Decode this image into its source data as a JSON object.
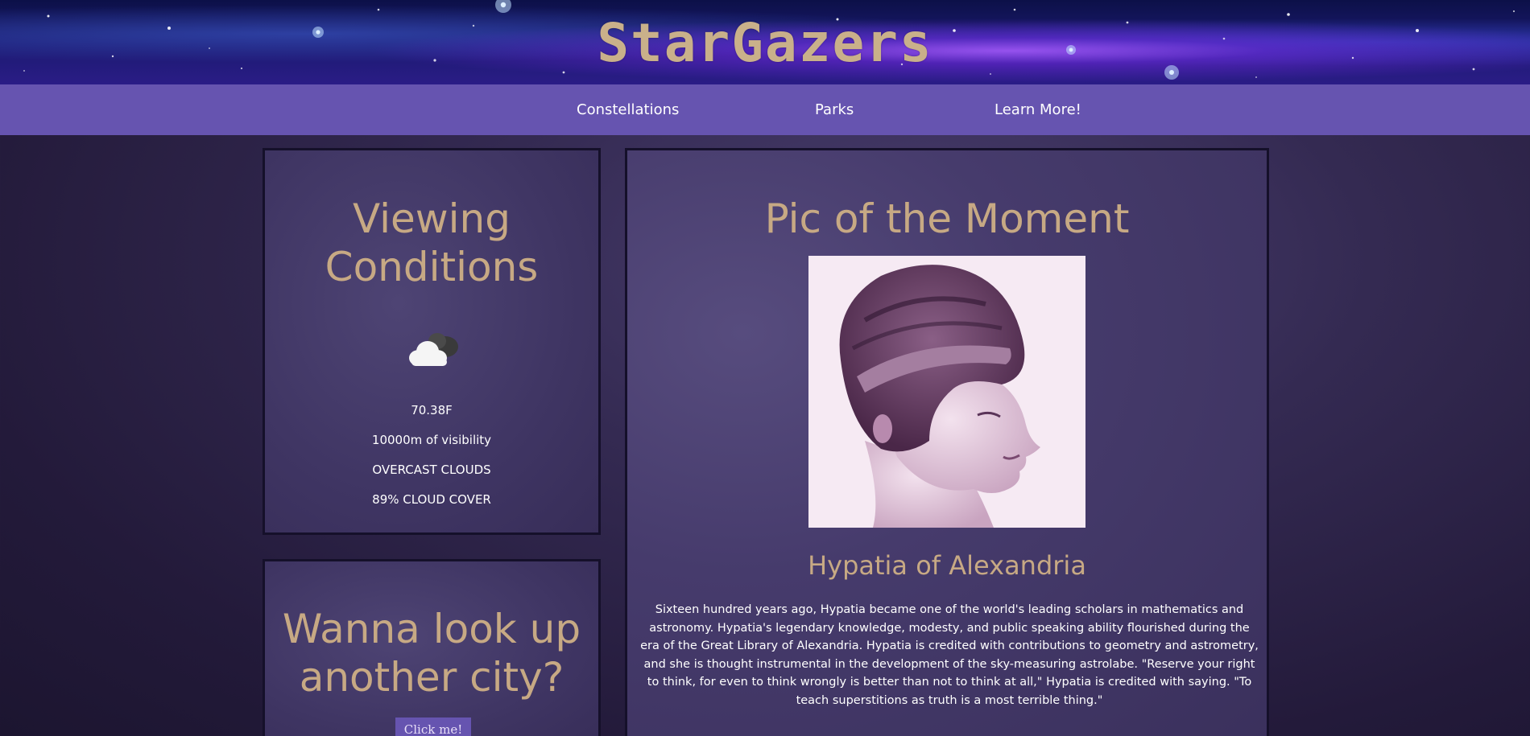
{
  "header": {
    "logo_text": "StarGazers"
  },
  "nav": {
    "items": [
      {
        "label": "Constellations"
      },
      {
        "label": "Parks"
      },
      {
        "label": "Learn More!"
      }
    ]
  },
  "weather": {
    "title": "Viewing Conditions",
    "icon": "overcast-cloud-icon",
    "temperature": "70.38F",
    "visibility": "10000m of visibility",
    "description": "OVERCAST CLOUDS",
    "cloud_cover": "89% CLOUD COVER"
  },
  "lookup": {
    "title": "Wanna look up another city?",
    "button_label": "Click me!"
  },
  "pic": {
    "title": "Pic of the Moment",
    "caption": "Hypatia of Alexandria",
    "description": "Sixteen hundred years ago, Hypatia became one of the world's leading scholars in mathematics and astronomy. Hypatia's legendary knowledge, modesty, and public speaking ability flourished during the era of the Great Library of Alexandria. Hypatia is credited with contributions to geometry and astrometry, and she is thought instrumental in the development of the sky-measuring astrolabe. \"Reserve your right to think, for even to think wrongly is better than not to think at all,\" Hypatia is credited with saying. \"To teach superstitions as truth is a most terrible thing.\""
  },
  "colors": {
    "accent": "#c7a984",
    "nav_bg": "#6654b0",
    "panel_bg": "#3f3563",
    "page_bg": "#231a3a"
  }
}
